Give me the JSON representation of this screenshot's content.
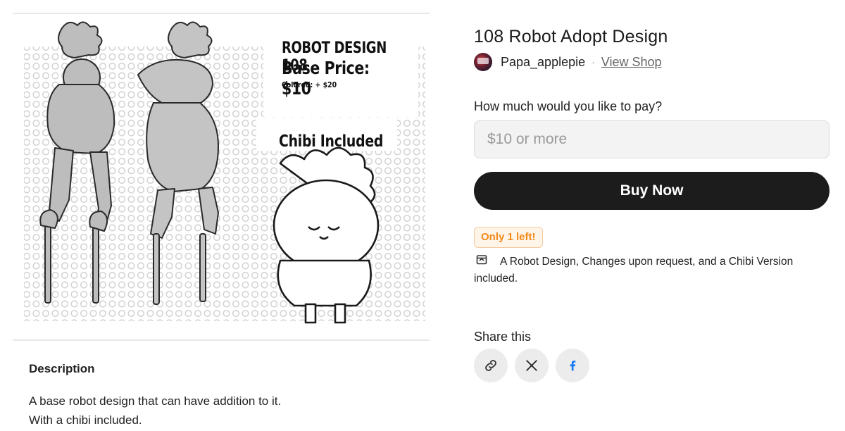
{
  "poster": {
    "title": "ROBOT DESIGN 108",
    "price": "Base Price: $10",
    "colored": "Colored:  + $20",
    "chibi": "Chibi Included"
  },
  "description": {
    "heading": "Description",
    "line1": "A base robot design that can have addition to it.",
    "line2": "With a chibi included."
  },
  "product": {
    "title": "108 Robot Adopt Design",
    "seller": "Papa_applepie",
    "separator": "·",
    "view_shop": "View Shop"
  },
  "purchase": {
    "pay_label": "How much would you like to pay?",
    "pay_placeholder": "$10 or more",
    "buy_label": "Buy Now",
    "stock_badge": "Only 1 left!",
    "includes": "A Robot Design, Changes upon request, and a Chibi Version included."
  },
  "share": {
    "label": "Share this",
    "buttons": [
      {
        "icon": "link-icon"
      },
      {
        "icon": "x-icon"
      },
      {
        "icon": "facebook-icon"
      }
    ]
  },
  "colors": {
    "buy_button": "#1c1c1c",
    "stock_text": "#f28a1a",
    "stock_bg": "#fff4e8",
    "facebook_blue": "#1877f2"
  }
}
